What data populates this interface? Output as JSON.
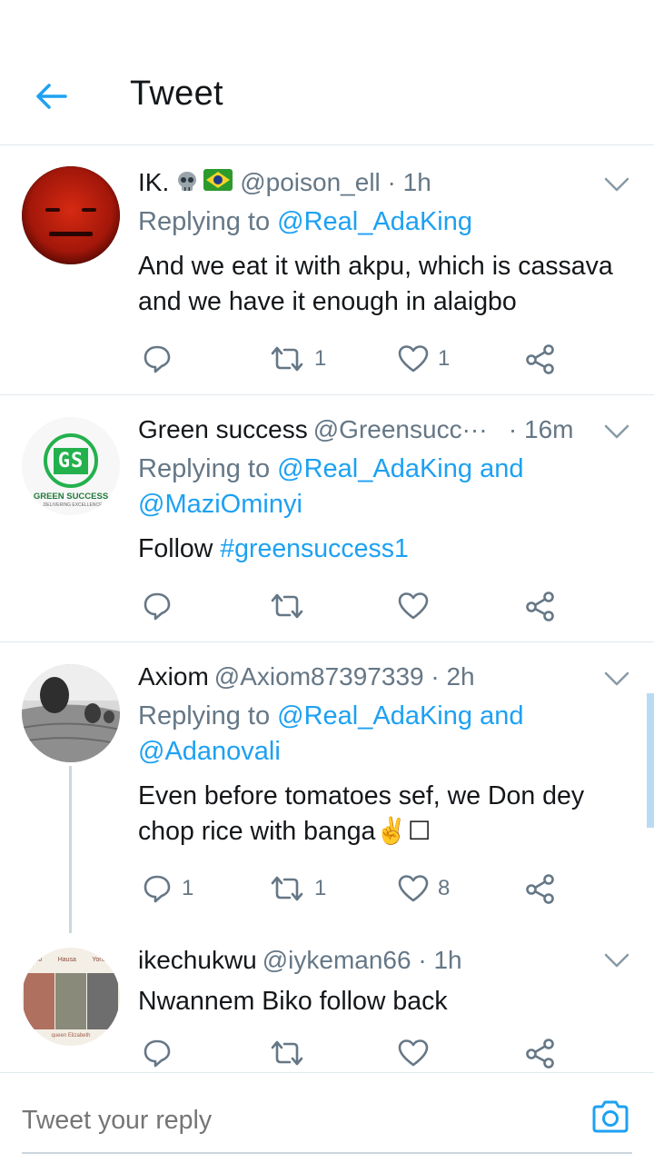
{
  "header": {
    "title": "Tweet"
  },
  "tweets": [
    {
      "name": "IK.",
      "emojis": "💀🇧🇷",
      "handle": "@poison_ell",
      "time": "· 1h",
      "replying_prefix": "Replying to ",
      "replying_to": "@Real_AdaKing",
      "replying_and": "",
      "replying_to2": "",
      "text_lines": [
        "And we eat it with akpu, which is cassava",
        "and we have it enough in alaigbo"
      ],
      "replies": "",
      "retweets": "1",
      "likes": "1"
    },
    {
      "name": "Green success",
      "handle": "@Greensucc···",
      "time": "· 16m",
      "avatar_title": "GS",
      "avatar_caption": "GREEN SUCCESS",
      "avatar_sub": "...DELIVERING EXCELLENCE",
      "replying_prefix": "Replying to ",
      "replying_to": "@Real_AdaKing",
      "replying_and": " and",
      "replying_to2": "@MaziOminyi",
      "text_prefix": "Follow ",
      "text_hashtag": "#greensuccess1",
      "replies": "",
      "retweets": "",
      "likes": ""
    },
    {
      "name": "Axiom",
      "handle": "@Axiom87397339",
      "time": "· 2h",
      "replying_prefix": "Replying to ",
      "replying_to": "@Real_AdaKing",
      "replying_and": " and",
      "replying_to2": "@Adanovali",
      "text_lines": [
        "Even before tomatoes sef, we Don dey",
        "chop rice with banga✌️☐"
      ],
      "replies": "1",
      "retweets": "1",
      "likes": "8"
    },
    {
      "name": "ikechukwu",
      "handle": "@iykeman66",
      "time": "· 1h",
      "avatar_labels": [
        "Igbo",
        "Hausa",
        "Yoruba"
      ],
      "avatar_caption": "queen Elizabeth",
      "text_lines": [
        "Nwannem Biko follow back"
      ],
      "replies": "",
      "retweets": "",
      "likes": ""
    }
  ],
  "reply_bar": {
    "placeholder": "Tweet your reply"
  },
  "colors": {
    "accent": "#1da1f2",
    "secondary_text": "#657786",
    "divider": "#e1e8ed"
  },
  "icons": [
    "back-arrow-icon",
    "chevron-down-icon",
    "reply-icon",
    "retweet-icon",
    "like-heart-icon",
    "share-icon",
    "camera-icon",
    "skull-emoji",
    "brazil-flag-emoji"
  ]
}
